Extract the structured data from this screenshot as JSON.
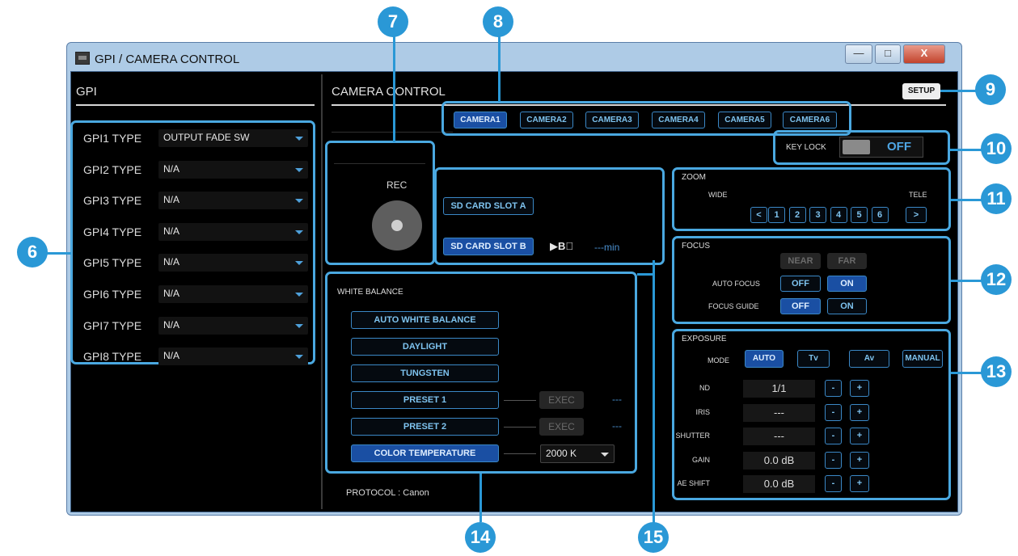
{
  "window": {
    "title": "GPI / CAMERA CONTROL",
    "min_glyph": "—",
    "max_glyph": "□",
    "close_glyph": "X"
  },
  "gpi": {
    "header": "GPI",
    "rows": [
      {
        "label": "GPI1 TYPE",
        "value": "OUTPUT FADE SW"
      },
      {
        "label": "GPI2 TYPE",
        "value": "N/A"
      },
      {
        "label": "GPI3 TYPE",
        "value": "N/A"
      },
      {
        "label": "GPI4 TYPE",
        "value": "N/A"
      },
      {
        "label": "GPI5 TYPE",
        "value": "N/A"
      },
      {
        "label": "GPI6 TYPE",
        "value": "N/A"
      },
      {
        "label": "GPI7 TYPE",
        "value": "N/A"
      },
      {
        "label": "GPI8 TYPE",
        "value": "N/A"
      }
    ]
  },
  "camera": {
    "header": "CAMERA CONTROL",
    "setup_label": "SETUP",
    "tabs": [
      "CAMERA1",
      "CAMERA2",
      "CAMERA3",
      "CAMERA4",
      "CAMERA5",
      "CAMERA6"
    ],
    "active_tab": "CAMERA1",
    "keylock": {
      "label": "KEY LOCK",
      "state": "OFF"
    },
    "rec": {
      "label": "REC"
    },
    "sd": {
      "slot_a": "SD CARD SLOT A",
      "slot_b": "SD CARD SLOT B",
      "slot_b_icon": "▶B⃠",
      "remaining": "---min"
    },
    "zoom": {
      "title": "ZOOM",
      "wide": "WIDE",
      "tele": "TELE",
      "wide_btn": "<",
      "tele_btn": ">",
      "presets": [
        "1",
        "2",
        "3",
        "4",
        "5",
        "6"
      ]
    },
    "focus": {
      "title": "FOCUS",
      "near": "NEAR",
      "far": "FAR",
      "auto_focus": "AUTO FOCUS",
      "focus_guide": "FOCUS GUIDE",
      "off": "OFF",
      "on": "ON"
    },
    "exposure": {
      "title": "EXPOSURE",
      "mode_label": "MODE",
      "modes": [
        "AUTO",
        "Tv",
        "Av",
        "MANUAL"
      ],
      "rows": [
        {
          "label": "ND",
          "value": "1/1"
        },
        {
          "label": "IRIS",
          "value": "---"
        },
        {
          "label": "SHUTTER",
          "value": "---"
        },
        {
          "label": "GAIN",
          "value": "0.0 dB"
        },
        {
          "label": "AE SHIFT",
          "value": "0.0 dB"
        }
      ],
      "minus": "-",
      "plus": "+"
    },
    "wb": {
      "title": "WHITE BALANCE",
      "auto": "AUTO WHITE BALANCE",
      "daylight": "DAYLIGHT",
      "tungsten": "TUNGSTEN",
      "preset1": "PRESET 1",
      "preset2": "PRESET 2",
      "exec": "EXEC",
      "dash": "---",
      "color_temp": "COLOR TEMPERATURE",
      "temp_value": "2000 K"
    },
    "protocol": "PROTOCOL : Canon"
  },
  "callouts": [
    "6",
    "7",
    "8",
    "9",
    "10",
    "11",
    "12",
    "13",
    "14",
    "15"
  ]
}
